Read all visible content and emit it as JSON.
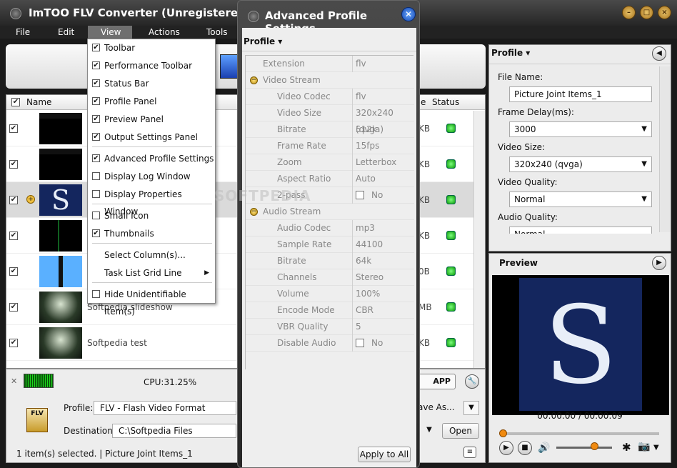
{
  "window": {
    "title": "ImTOO FLV Converter (Unregistered)"
  },
  "menubar": {
    "items": [
      "File",
      "Edit",
      "View",
      "Actions",
      "Tools"
    ]
  },
  "list": {
    "header": {
      "name": "Name",
      "size": "e",
      "status": "Status"
    },
    "rows": [
      {
        "checked": true,
        "name": "",
        "size": "KB",
        "thumb": "dark-title"
      },
      {
        "checked": true,
        "name": "",
        "size": "KB",
        "thumb": "dark-title"
      },
      {
        "checked": true,
        "name": "",
        "size": "KB",
        "thumb": "s-logo",
        "selected": true
      },
      {
        "checked": true,
        "name": "",
        "size": "KB",
        "thumb": "green-line"
      },
      {
        "checked": true,
        "name": "",
        "size": "0B",
        "thumb": "blue-tiles"
      },
      {
        "checked": true,
        "name": "Softpedia slideshow",
        "size": "MB",
        "thumb": "forest"
      },
      {
        "checked": true,
        "name": "Softpedia test",
        "size": "KB",
        "thumb": "forest"
      }
    ]
  },
  "view_menu": {
    "items": [
      {
        "label": "Toolbar",
        "checked": true
      },
      {
        "label": "Performance Toolbar",
        "checked": true
      },
      {
        "label": "Status Bar",
        "checked": true
      },
      {
        "label": "Profile Panel",
        "checked": true
      },
      {
        "label": "Preview Panel",
        "checked": true
      },
      {
        "label": "Output Settings Panel",
        "checked": true
      },
      {
        "label": "Advanced Profile Settings",
        "checked": true
      },
      {
        "label": "Display Log Window",
        "checked": false
      },
      {
        "label": "Display Properties Window",
        "checked": false
      },
      {
        "label": "Small Icon",
        "checked": false
      },
      {
        "label": "Thumbnails",
        "checked": true
      },
      {
        "label": "Select Column(s)...",
        "checked": null
      },
      {
        "label": "Task List Grid Line",
        "checked": null
      },
      {
        "label": "Hide Unidentifiable Item(s)",
        "checked": false
      }
    ]
  },
  "advanced_dialog": {
    "title": "Advanced Profile Settings",
    "profile_label": "Profile",
    "rows": [
      {
        "k": "Extension",
        "v": "flv"
      },
      {
        "k": "Video Stream",
        "v": "",
        "group": true
      },
      {
        "k": "Video Codec",
        "v": "flv"
      },
      {
        "k": "Video Size",
        "v": "320x240 (qvga)"
      },
      {
        "k": "Bitrate",
        "v": "512k"
      },
      {
        "k": "Frame Rate",
        "v": "15fps"
      },
      {
        "k": "Zoom",
        "v": "Letterbox"
      },
      {
        "k": "Aspect Ratio",
        "v": "Auto"
      },
      {
        "k": "2-pass",
        "v": "No",
        "checkbox": true
      },
      {
        "k": "Audio Stream",
        "v": "",
        "group": true
      },
      {
        "k": "Audio Codec",
        "v": "mp3"
      },
      {
        "k": "Sample Rate",
        "v": "44100"
      },
      {
        "k": "Bitrate",
        "v": "64k"
      },
      {
        "k": "Channels",
        "v": "Stereo"
      },
      {
        "k": "Volume",
        "v": "100%"
      },
      {
        "k": "Encode Mode",
        "v": "CBR"
      },
      {
        "k": "VBR Quality",
        "v": "5"
      },
      {
        "k": "Disable Audio",
        "v": "No",
        "checkbox": true
      }
    ],
    "apply_label": "Apply to All"
  },
  "bottom": {
    "cpu": "CPU:31.25%",
    "profile_label": "Profile:",
    "profile_value": "FLV - Flash Video Format",
    "save_as": "ave As...",
    "destination_label": "Destination:",
    "destination_value": "C:\\Softpedia Files",
    "open_label": "Open",
    "app_label": "APP",
    "status_text": "1 item(s) selected. | Picture Joint Items_1"
  },
  "profile_panel": {
    "title": "Profile",
    "file_name_label": "File Name:",
    "file_name_value": "Picture Joint Items_1",
    "frame_delay_label": "Frame Delay(ms):",
    "frame_delay_value": "3000",
    "video_size_label": "Video Size:",
    "video_size_value": "320x240 (qvga)",
    "video_quality_label": "Video Quality:",
    "video_quality_value": "Normal",
    "audio_quality_label": "Audio Quality:",
    "audio_quality_value": "Normal"
  },
  "preview": {
    "title": "Preview",
    "time": "00:00:00 / 00:00:09",
    "logo_letter": "S"
  },
  "watermark": "SOFTPEDIA"
}
